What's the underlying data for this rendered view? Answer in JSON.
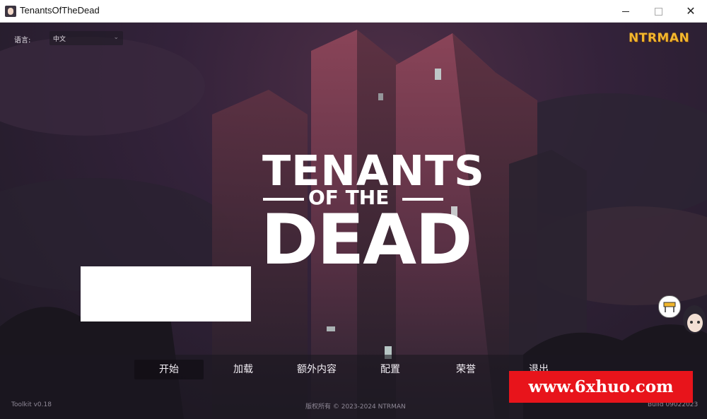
{
  "window": {
    "title": "TenantsOfTheDead",
    "app_icon": "game-portrait-icon",
    "controls": {
      "minimize": "minimize-icon",
      "maximize": "maximize-icon",
      "close": "close-icon"
    }
  },
  "header": {
    "language_label": "语言:",
    "language_value": "中文",
    "brand": "NTRMAN"
  },
  "logo": {
    "line1": "TENANTS",
    "line2": "OF THE",
    "line3": "DEAD"
  },
  "menu": {
    "items": [
      {
        "label": "开始",
        "active": true
      },
      {
        "label": "加载"
      },
      {
        "label": "额外内容"
      },
      {
        "label": "配置"
      },
      {
        "label": "荣誉"
      },
      {
        "label": "退出"
      }
    ]
  },
  "footer": {
    "version": "Toolkit v0.18",
    "copyright": "版权所有 © 2023-2024 NTRMAN",
    "build": "Build 09022023"
  },
  "watermark": {
    "text": "www.6xhuo.com"
  },
  "colors": {
    "brand": "#f2b62d",
    "watermark_bg": "#e8141b",
    "sky": "#33223a",
    "building": "#7a3c4e"
  }
}
